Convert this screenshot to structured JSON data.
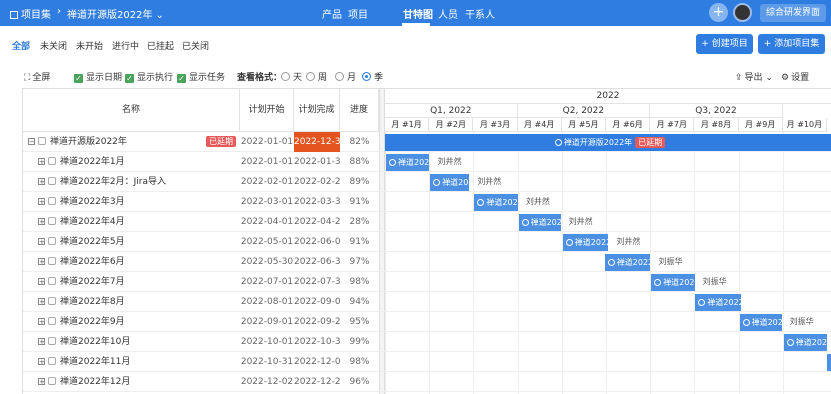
{
  "topbar": {
    "crumb_root": "项目集",
    "crumb_sep": "›",
    "crumb_current": "禅道开源版2022年",
    "nav": [
      "产品",
      "项目",
      "甘特图",
      "人员",
      "干系人"
    ],
    "active_nav": "甘特图",
    "plus": "+",
    "right_button": "综合研发界面"
  },
  "filters": [
    "全部",
    "未关闭",
    "未开始",
    "进行中",
    "已挂起",
    "已关闭"
  ],
  "active_filter": "全部",
  "actions": {
    "create": "+ 创建项目",
    "add_set": "+ 添加项目集"
  },
  "options": {
    "fullscreen": "全屏",
    "show_date": "显示日期",
    "show_exec": "显示执行",
    "show_task": "显示任务",
    "view_format": "查看格式：",
    "formats": [
      "天",
      "周",
      "月",
      "季"
    ],
    "selected_format": "季",
    "export": "导出",
    "settings": "设置"
  },
  "table": {
    "headers": {
      "name": "名称",
      "start": "计划开始",
      "end": "计划完成",
      "progress": "进度"
    },
    "rows": [
      {
        "name": "禅道开源版2022年",
        "badge": "已延期",
        "start": "2022-01-01",
        "end": "2022-12-30",
        "progress": "82%",
        "owner": ""
      },
      {
        "name": "禅道2022年1月",
        "start": "2022-01-01",
        "end": "2022-01-30",
        "progress": "88%",
        "owner": "刘井然"
      },
      {
        "name": "禅道2022年2月：Jira导入",
        "start": "2022-02-01",
        "end": "2022-02-27",
        "progress": "89%",
        "owner": "刘井然"
      },
      {
        "name": "禅道2022年3月",
        "start": "2022-03-01",
        "end": "2022-03-30",
        "progress": "91%",
        "owner": "刘井然"
      },
      {
        "name": "禅道2022年4月",
        "start": "2022-04-01",
        "end": "2022-04-29",
        "progress": "28%",
        "owner": "刘井然"
      },
      {
        "name": "禅道2022年5月",
        "start": "2022-05-01",
        "end": "2022-06-01",
        "progress": "91%",
        "owner": "刘井然"
      },
      {
        "name": "禅道2022年6月",
        "start": "2022-05-30",
        "end": "2022-06-30",
        "progress": "97%",
        "owner": "刘振华"
      },
      {
        "name": "禅道2022年7月",
        "start": "2022-07-01",
        "end": "2022-07-30",
        "progress": "98%",
        "owner": "刘振华"
      },
      {
        "name": "禅道2022年8月",
        "start": "2022-08-01",
        "end": "2022-09-01",
        "progress": "94%",
        "owner": ""
      },
      {
        "name": "禅道2022年9月",
        "start": "2022-09-01",
        "end": "2022-09-29",
        "progress": "95%",
        "owner": "刘振华"
      },
      {
        "name": "禅道2022年10月",
        "start": "2022-10-01",
        "end": "2022-10-30",
        "progress": "99%",
        "owner": ""
      },
      {
        "name": "禅道2022年11月",
        "start": "2022-10-31",
        "end": "2022-12-01",
        "progress": "98%",
        "owner": ""
      },
      {
        "name": "禅道2022年12月",
        "start": "2022-12-02",
        "end": "2022-12-29",
        "progress": "96%",
        "owner": ""
      }
    ]
  },
  "gantt": {
    "year": "2022",
    "quarters": [
      "Q1, 2022",
      "Q2, 2022",
      "Q3, 2022"
    ],
    "months": [
      "月 #1月",
      "月 #2月",
      "月 #3月",
      "月 #4月",
      "月 #5月",
      "月 #6月",
      "月 #7月",
      "月 #8月",
      "月 #9月",
      "月 #10月"
    ],
    "bar_labels": [
      "禅道开源版2022年",
      "禅道2022",
      "禅道2022",
      "禅道2022",
      "禅道2022",
      "禅道2022",
      "禅道2022年",
      "禅道2022",
      "禅道2022",
      "禅道2022",
      "禅道2022"
    ],
    "parent_badge": "已延期"
  },
  "colors": {
    "primary": "#2f7de1",
    "bar": "#4b90e3",
    "delay": "#e65a5a",
    "end_highlight": "#e3541f",
    "check": "#4aa35b"
  }
}
